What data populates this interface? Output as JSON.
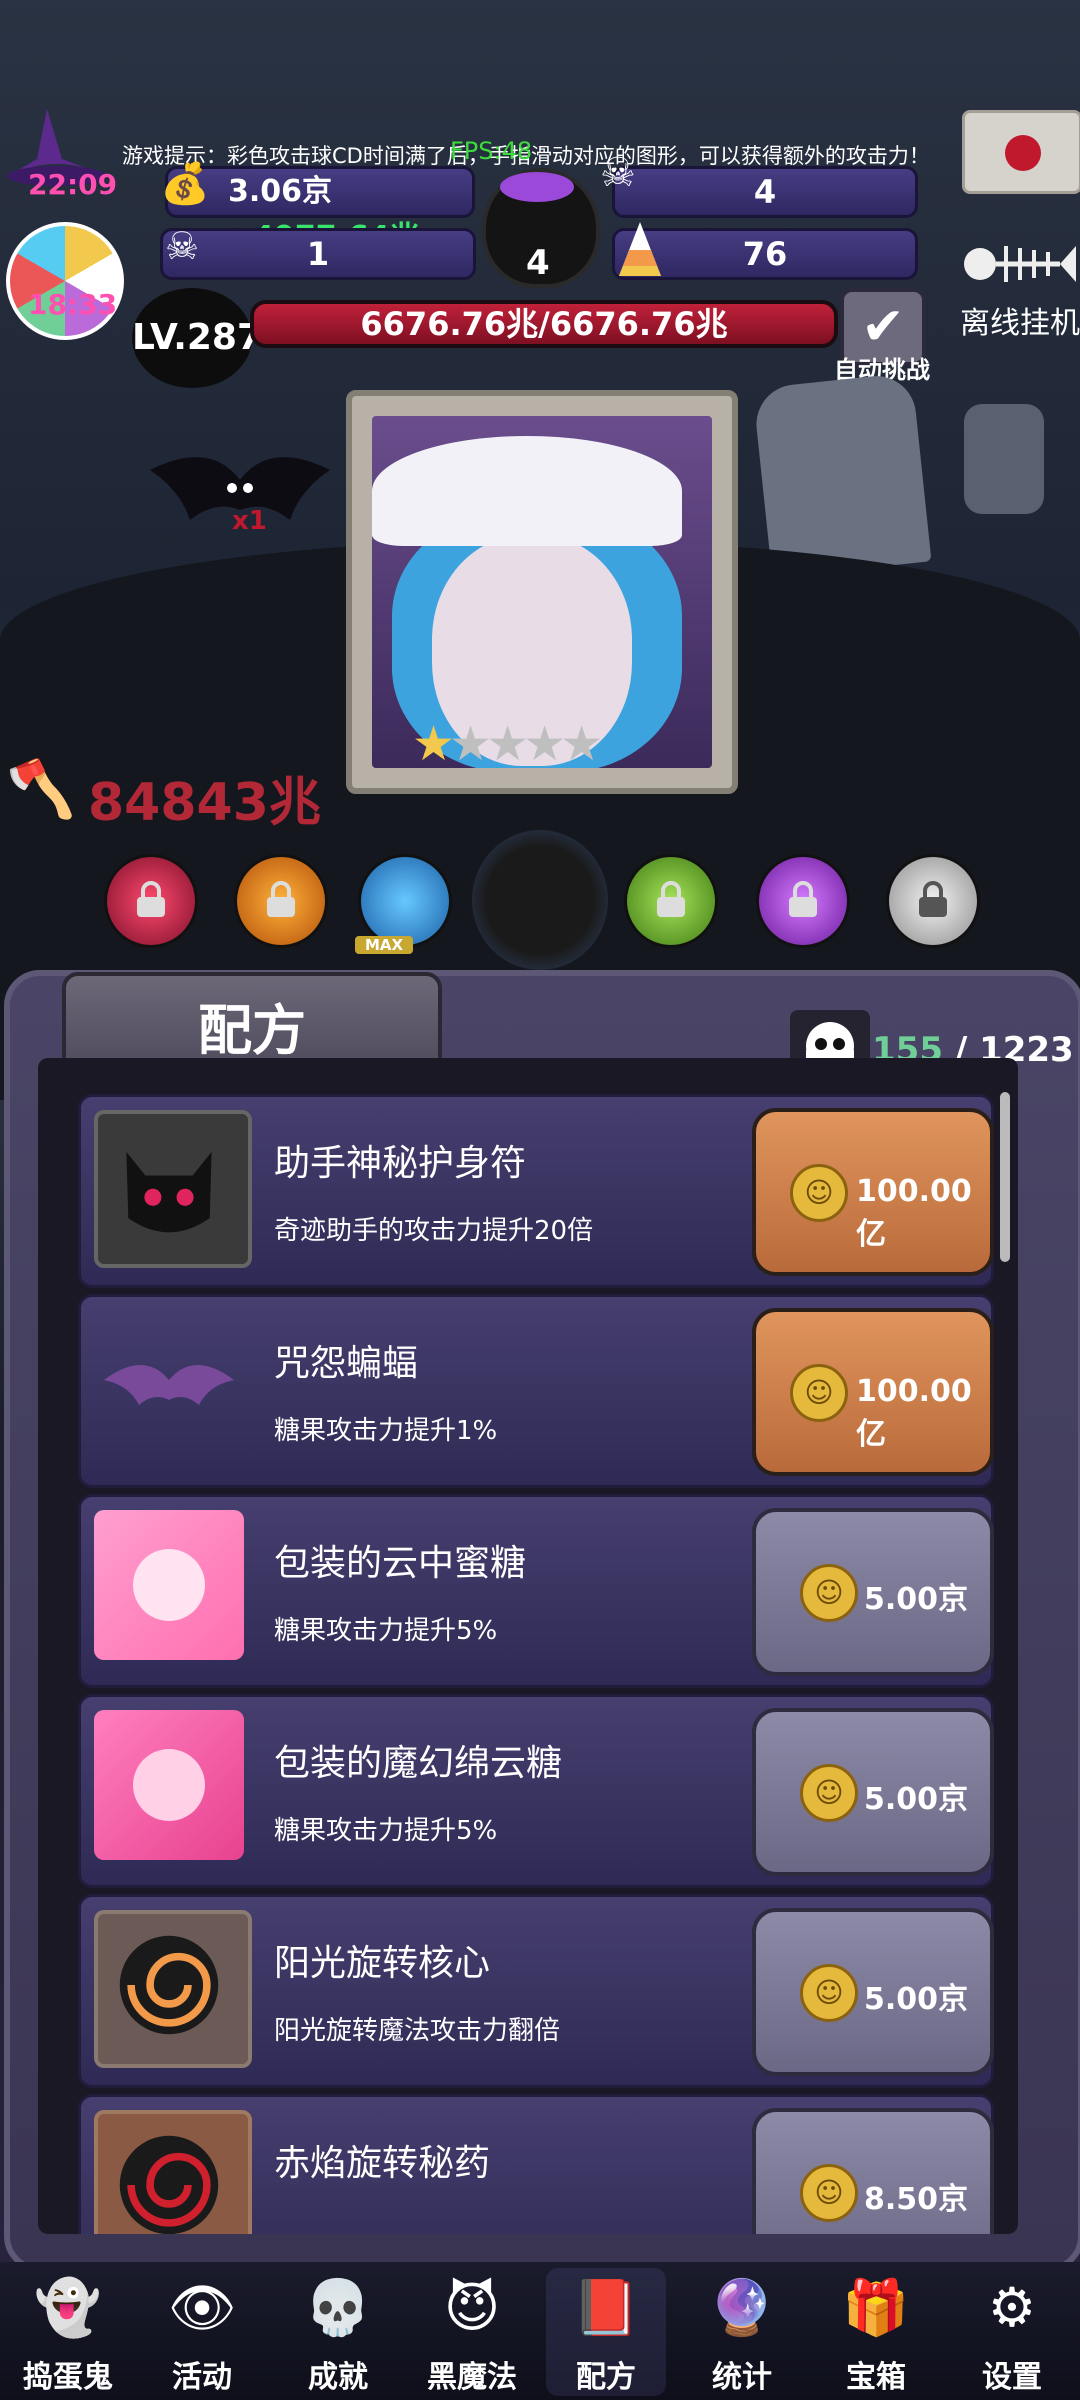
{
  "tip": "游戏提示：彩色攻击球CD时间满了后，手指滑动对应的图形，可以获得额外的攻击力！",
  "fps": "FPS:48",
  "timers": {
    "hat_time": "22:09",
    "candy_time": "18:33"
  },
  "resources": {
    "gold": "3.06京",
    "gold_rate": "+4977.64兆",
    "skull_count": "4",
    "bombs": "1",
    "candy_corn": "76",
    "cauldron": "4"
  },
  "level": "LV.287",
  "hp": "6676.76兆/6676.76兆",
  "auto_challenge": "自动挑战",
  "offline": "离线挂机",
  "damage": "84843兆",
  "multiplier": "x1",
  "orbs_max": "MAX",
  "recipe": {
    "title": "配方",
    "count_current": "155",
    "count_total": "/ 1223",
    "items": [
      {
        "name": "助手神秘护身符",
        "desc": "奇迹助手的攻击力提升20倍",
        "price": "100.00亿",
        "style": "orange"
      },
      {
        "name": "咒怨蝙蝠",
        "desc": "糖果攻击力提升1%",
        "price": "100.00亿",
        "style": "orange"
      },
      {
        "name": "包装的云中蜜糖",
        "desc": "糖果攻击力提升5%",
        "price": "5.00京",
        "style": "gray"
      },
      {
        "name": "包装的魔幻绵云糖",
        "desc": "糖果攻击力提升5%",
        "price": "5.00京",
        "style": "gray"
      },
      {
        "name": "阳光旋转核心",
        "desc": "阳光旋转魔法攻击力翻倍",
        "price": "5.00京",
        "style": "gray"
      },
      {
        "name": "赤焰旋转秘药",
        "desc": "",
        "price": "8.50京",
        "style": "gray"
      }
    ]
  },
  "nav": [
    "捣蛋鬼",
    "活动",
    "成就",
    "黑魔法",
    "配方",
    "统计",
    "宝箱",
    "设置"
  ],
  "colors": {
    "gold_rate": "#39e46b",
    "damage": "#b32837",
    "hp_bar": "#a3182e",
    "orange_btn": "#d88a52",
    "gray_btn": "#807d9c"
  }
}
